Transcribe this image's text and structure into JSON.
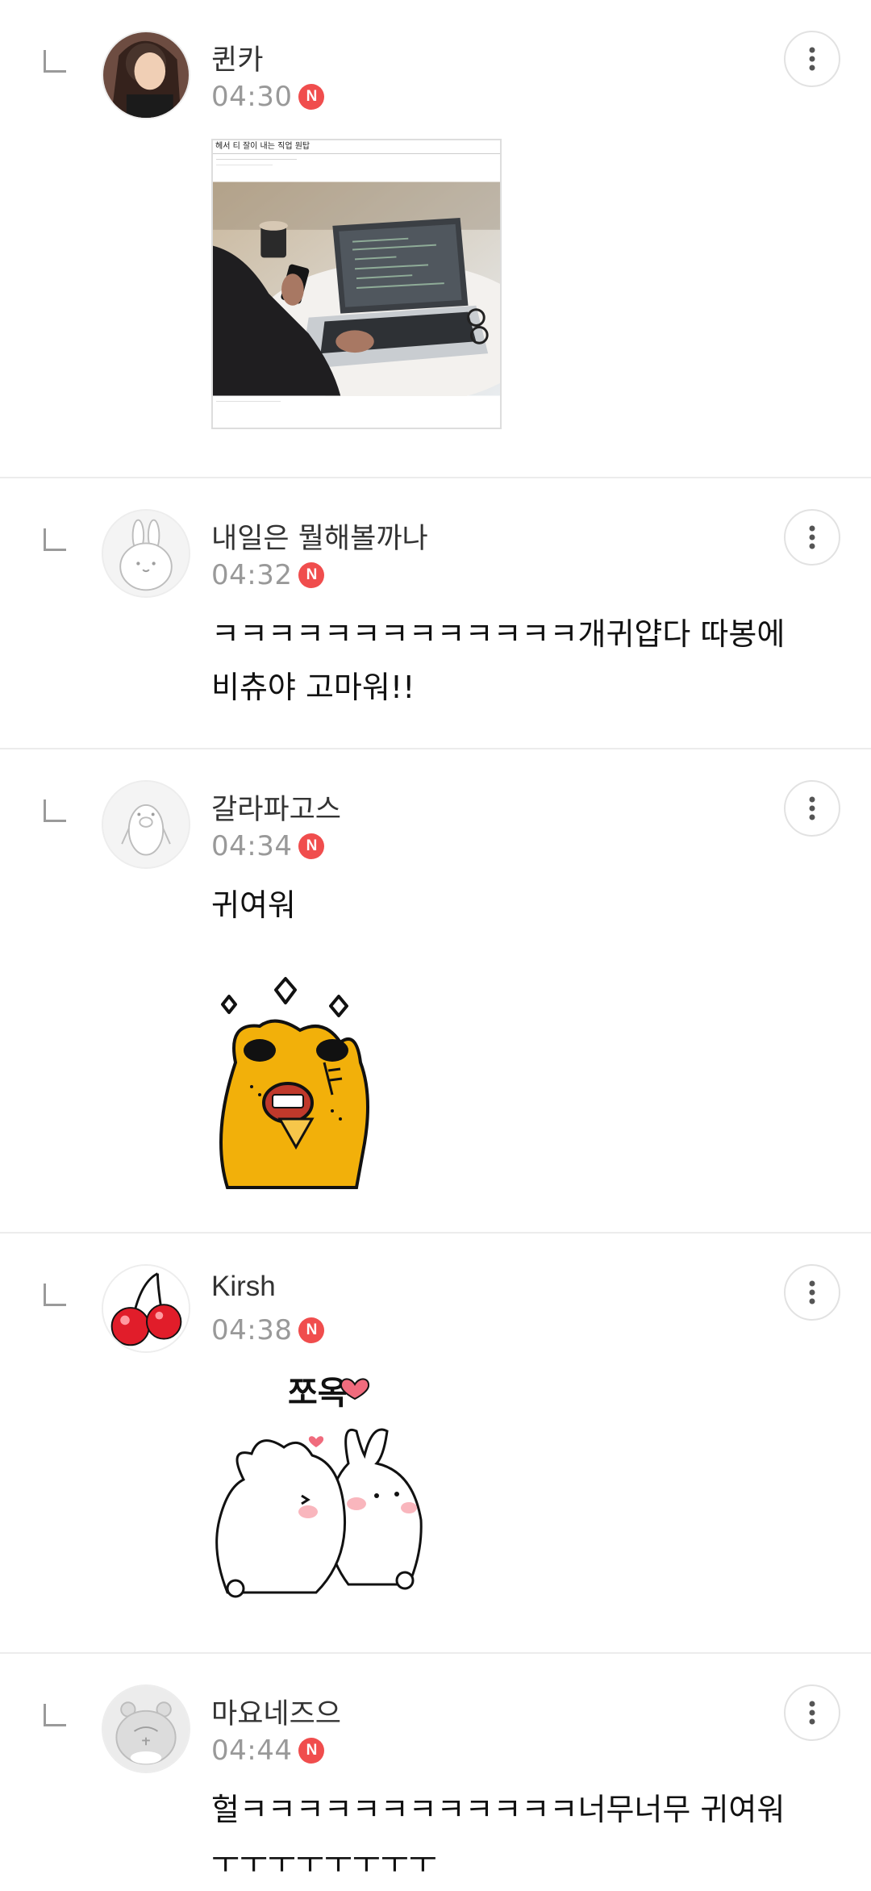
{
  "comments": [
    {
      "nickname": "퀸카",
      "time": "04:30",
      "badge": "N",
      "text": "",
      "image_caption": "헤서 티 잘이 내는 직업 원탑"
    },
    {
      "nickname": "내일은 뭘해볼까나",
      "time": "04:32",
      "badge": "N",
      "text": "ㅋㅋㅋㅋㅋㅋㅋㅋㅋㅋㅋㅋㅋ개귀얍다 따봉에비츄야 고마워!!"
    },
    {
      "nickname": "갈라파고스",
      "time": "04:34",
      "badge": "N",
      "text": "귀여워"
    },
    {
      "nickname": "Kirsh",
      "time": "04:38",
      "badge": "N",
      "text": "",
      "sticker_text": "쪼옥"
    },
    {
      "nickname": "마요네즈으",
      "time": "04:44",
      "badge": "N",
      "text": "헐ㅋㅋㅋㅋㅋㅋㅋㅋㅋㅋㅋㅋ너무너무 귀여워ㅜㅜㅜㅜㅜㅜㅜㅜ"
    }
  ],
  "icons": {
    "reply": "reply-indent-icon",
    "more": "more-vertical-icon"
  },
  "colors": {
    "badge": "#f04d4d",
    "divider": "#ececec",
    "timestamp": "#999999"
  }
}
